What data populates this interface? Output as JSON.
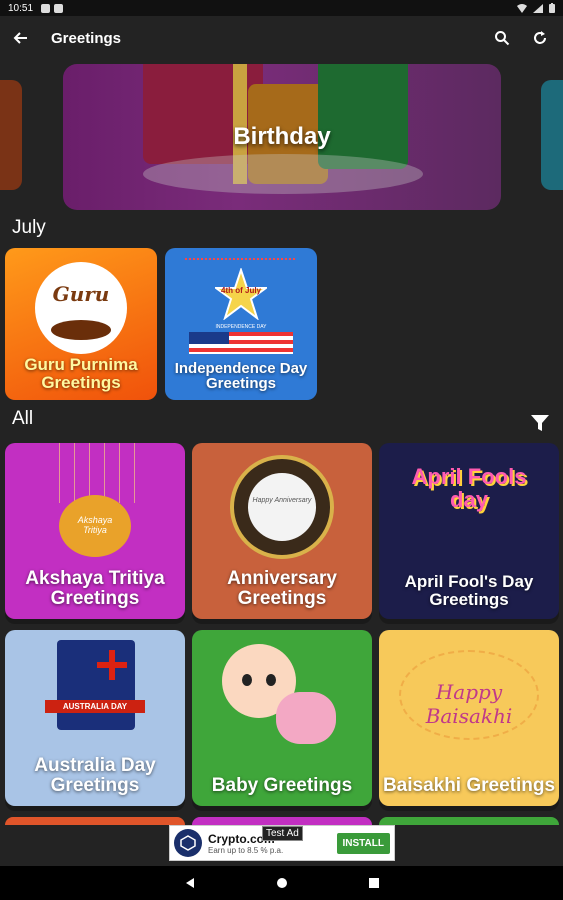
{
  "status": {
    "time": "10:51"
  },
  "app_bar": {
    "title": "Greetings"
  },
  "carousel": {
    "title": "Birthday"
  },
  "sections": {
    "july": "July",
    "all": "All"
  },
  "july_cards": [
    {
      "title": "Guru Purnima Greetings",
      "art_text": "Guru"
    },
    {
      "title": "Independence Day Greetings",
      "art_text": "4th of July",
      "art_sub": "INDEPENDENCE DAY"
    }
  ],
  "all_cards": [
    {
      "title": "Akshaya Tritiya Greetings",
      "art_text": "Akshaya Tritiya"
    },
    {
      "title": "Anniversary Greetings",
      "art_text": "Happy Anniversary"
    },
    {
      "title": "April Fool's Day Greetings",
      "art_text": "April Fools day"
    },
    {
      "title": "Australia Day Greetings",
      "art_text": "AUSTRALIA DAY"
    },
    {
      "title": "Baby Greetings"
    },
    {
      "title": "Baisakhi Greetings",
      "art_text": "Happy Baisakhi"
    }
  ],
  "ad": {
    "label": "Test Ad",
    "title": "Crypto.com",
    "subtitle": "Earn up to 8.5 % p.a.",
    "install": "INSTALL"
  },
  "colors": {
    "background": "#232323",
    "guru": "#f26a10",
    "independence": "#2f7ad6",
    "akshaya": "#c22fc2",
    "anniversary": "#c8613c",
    "april": "#1c1d4a",
    "australia": "#a9c4e6",
    "baby": "#3fa63a",
    "baisakhi": "#f7c95a"
  }
}
